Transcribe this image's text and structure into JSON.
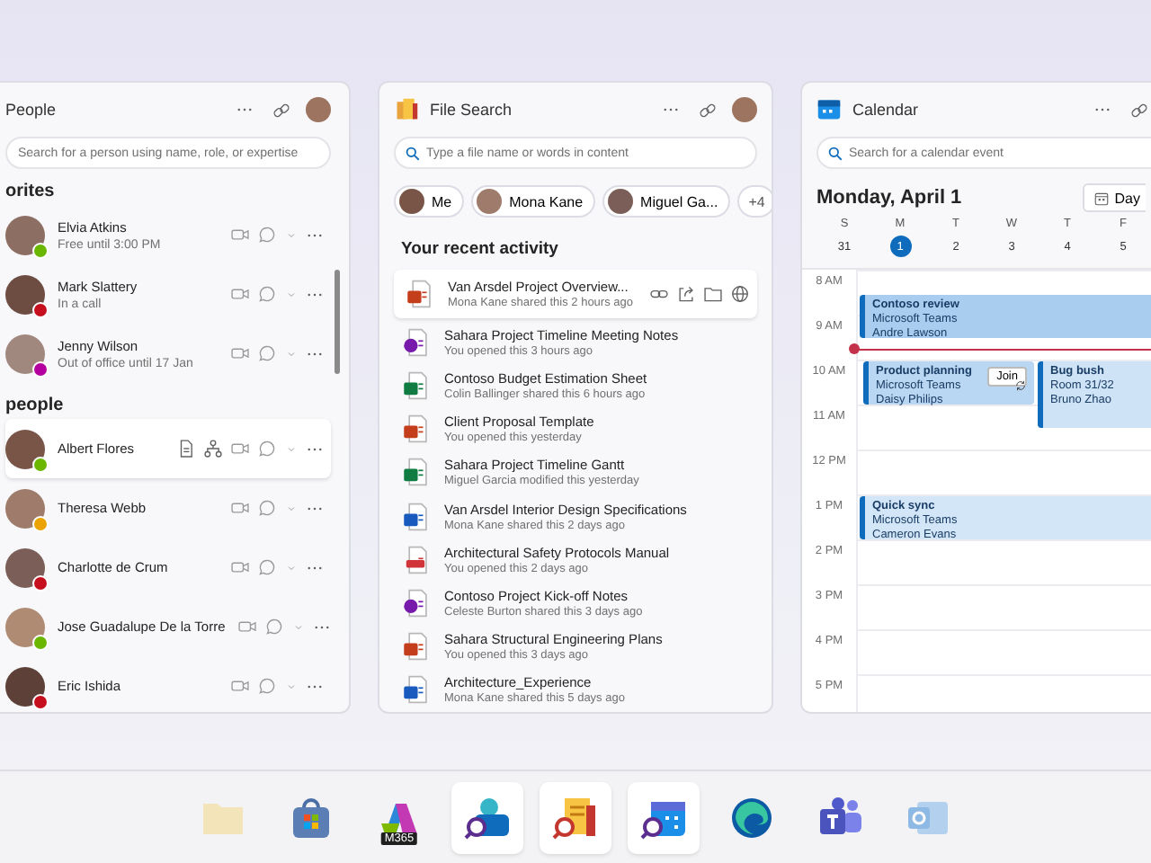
{
  "people_panel": {
    "title": "People",
    "search_placeholder": "Search for a person using name, role, or expertise",
    "sections": [
      {
        "heading": "orites",
        "people": [
          {
            "name": "Elvia Atkins",
            "status_text": "Free until 3:00 PM",
            "color": "#6bb700",
            "selected": false
          },
          {
            "name": "Mark Slattery",
            "status_text": "In a call",
            "color": "#c50f1f",
            "selected": false
          },
          {
            "name": "Jenny Wilson",
            "status_text": "Out of office until 17 Jan",
            "color": "#b4009e",
            "selected": false
          }
        ]
      },
      {
        "heading": "people",
        "people": [
          {
            "name": "Albert Flores",
            "color": "#6bb700",
            "selected": true
          },
          {
            "name": "Theresa Webb",
            "color": "#eaa300",
            "selected": false
          },
          {
            "name": "Charlotte de Crum",
            "color": "#c50f1f",
            "selected": false
          },
          {
            "name": "Jose Guadalupe De la Torre",
            "color": "#6bb700",
            "selected": false
          },
          {
            "name": "Eric Ishida",
            "color": "#c50f1f",
            "selected": false
          }
        ]
      }
    ]
  },
  "file_panel": {
    "title": "File Search",
    "search_placeholder": "Type a file name or words in content",
    "filters": [
      {
        "label": "Me",
        "kind": "person"
      },
      {
        "label": "Mona Kane",
        "kind": "person"
      },
      {
        "label": "Miguel Ga...",
        "kind": "person"
      },
      {
        "label": "+4",
        "kind": "count"
      }
    ],
    "section_heading": "Your recent activity",
    "files": [
      {
        "kind": "powerpoint",
        "name": "Van Arsdel Project Overview...",
        "detail": "Mona Kane shared this 2 hours ago",
        "selected": true
      },
      {
        "kind": "onenote",
        "name": "Sahara Project Timeline Meeting Notes",
        "detail": "You opened this 3 hours ago",
        "selected": false
      },
      {
        "kind": "excel",
        "name": "Contoso Budget Estimation Sheet",
        "detail": "Colin Ballinger shared this 6 hours ago",
        "selected": false
      },
      {
        "kind": "powerpoint",
        "name": "Client Proposal Template",
        "detail": "You opened this yesterday",
        "selected": false
      },
      {
        "kind": "excel",
        "name": "Sahara Project Timeline Gantt",
        "detail": "Miguel Garcia modified this yesterday",
        "selected": false
      },
      {
        "kind": "word",
        "name": "Van Arsdel Interior Design Specifications",
        "detail": "Mona Kane shared this 2 days ago",
        "selected": false
      },
      {
        "kind": "pdf",
        "name": "Architectural Safety Protocols Manual",
        "detail": "You opened this 2 days ago",
        "selected": false
      },
      {
        "kind": "onenote",
        "name": "Contoso Project Kick-off  Notes",
        "detail": "Celeste Burton shared this 3 days ago",
        "selected": false
      },
      {
        "kind": "powerpoint",
        "name": "Sahara Structural Engineering Plans",
        "detail": "You opened this 3 days ago",
        "selected": false
      },
      {
        "kind": "word",
        "name": "Architecture_Experience",
        "detail": "Mona Kane shared this 5 days ago",
        "selected": false
      }
    ]
  },
  "calendar_panel": {
    "title": "Calendar",
    "search_placeholder": "Search for a calendar event",
    "date_heading": "Monday, April 1",
    "view_button": "Day",
    "week": [
      {
        "weekday": "S",
        "date": "31",
        "selected": false
      },
      {
        "weekday": "M",
        "date": "1",
        "selected": true
      },
      {
        "weekday": "T",
        "date": "2",
        "selected": false
      },
      {
        "weekday": "W",
        "date": "3",
        "selected": false
      },
      {
        "weekday": "T",
        "date": "4",
        "selected": false
      },
      {
        "weekday": "F",
        "date": "5",
        "selected": false
      }
    ],
    "hours": [
      "8 AM",
      "9 AM",
      "10 AM",
      "11 AM",
      "12 PM",
      "1 PM",
      "2 PM",
      "3 PM",
      "4 PM",
      "5 PM"
    ],
    "events": [
      {
        "title": "Contoso review",
        "lines": [
          "Microsoft Teams",
          "Andre Lawson"
        ],
        "color": "#a8cdee"
      },
      {
        "title": "Product planning",
        "lines": [
          "Microsoft Teams",
          "Daisy Philips"
        ],
        "color": "#b9d7f2",
        "join_label": "Join",
        "recurring": true
      },
      {
        "title": "Bug bush",
        "lines": [
          "Room 31/32",
          "Bruno Zhao"
        ],
        "color": "#cfe3f6"
      },
      {
        "title": "Quick sync",
        "lines": [
          "Microsoft Teams",
          "Cameron Evans"
        ],
        "color": "#d3e6f7"
      }
    ]
  },
  "taskbar": {
    "apps": [
      {
        "kind": "folder",
        "open": false
      },
      {
        "kind": "store",
        "open": false
      },
      {
        "kind": "m365",
        "open": false,
        "badge": "M365"
      },
      {
        "kind": "people_search",
        "open": true
      },
      {
        "kind": "file_search",
        "open": true
      },
      {
        "kind": "calendar_search",
        "open": true
      },
      {
        "kind": "edge",
        "open": false
      },
      {
        "kind": "teams",
        "open": false
      },
      {
        "kind": "outlook",
        "open": false
      }
    ]
  }
}
